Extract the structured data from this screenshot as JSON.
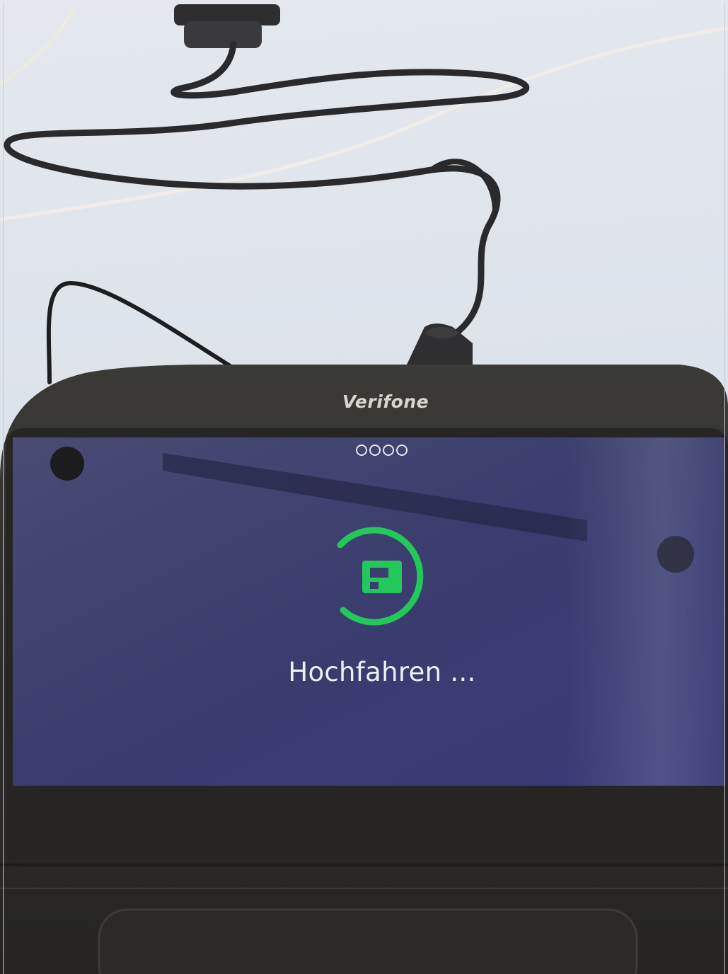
{
  "device": {
    "brand": "Verifone"
  },
  "screen": {
    "status_text": "Hochfahren ...",
    "progress_dots": 4,
    "background_color": "#3d3f70",
    "accent_color": "#22c95a"
  },
  "icons": {
    "spinner": "loading-ring-icon",
    "logo": "terminal-logo-icon",
    "cable": "power-cable"
  }
}
